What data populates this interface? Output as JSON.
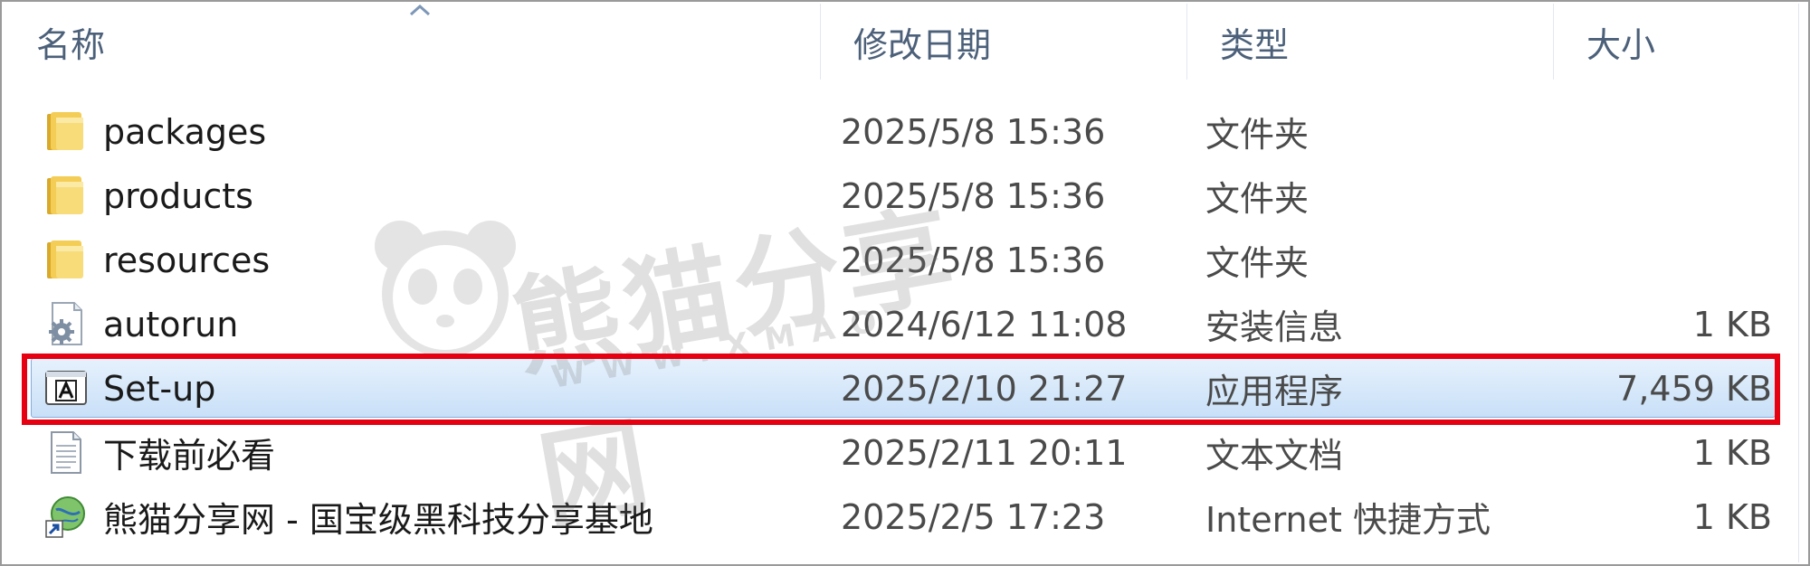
{
  "columns": {
    "name": "名称",
    "modified": "修改日期",
    "type": "类型",
    "size": "大小"
  },
  "files": [
    {
      "name": "packages",
      "modified": "2025/5/8 15:36",
      "type": "文件夹",
      "size": "",
      "icon": "folder-icon"
    },
    {
      "name": "products",
      "modified": "2025/5/8 15:36",
      "type": "文件夹",
      "size": "",
      "icon": "folder-icon"
    },
    {
      "name": "resources",
      "modified": "2025/5/8 15:36",
      "type": "文件夹",
      "size": "",
      "icon": "folder-icon"
    },
    {
      "name": "autorun",
      "modified": "2024/6/12 11:08",
      "type": "安装信息",
      "size": "1 KB",
      "icon": "settings-file-icon"
    },
    {
      "name": "Set-up",
      "modified": "2025/2/10 21:27",
      "type": "应用程序",
      "size": "7,459 KB",
      "icon": "adobe-app-icon",
      "selected": true
    },
    {
      "name": "下载前必看",
      "modified": "2025/2/11 20:11",
      "type": "文本文档",
      "size": "1 KB",
      "icon": "text-file-icon"
    },
    {
      "name": "熊猫分享网 - 国宝级黑科技分享基地",
      "modified": "2025/2/5 17:23",
      "type": "Internet 快捷方式",
      "size": "1 KB",
      "icon": "internet-shortcut-icon"
    }
  ],
  "watermark": {
    "title": "熊猫分享网",
    "url": "WWW.XMAO"
  },
  "colors": {
    "highlight": "#e50012",
    "selection": "#c9e0f8",
    "header_text": "#4c607a"
  }
}
